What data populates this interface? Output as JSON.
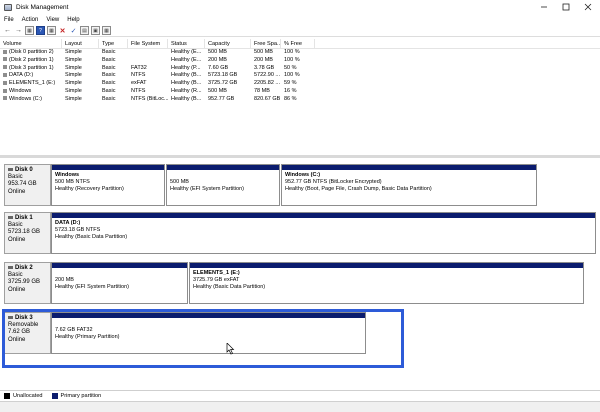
{
  "window": {
    "title": "Disk Management"
  },
  "menu": [
    "File",
    "Action",
    "View",
    "Help"
  ],
  "toolbar": {
    "icons": [
      "back-arrow-icon",
      "forward-arrow-icon",
      "properties-icon",
      "help-icon",
      "refresh-icon",
      "delete-icon",
      "check-icon",
      "properties-sheet-icon",
      "new-volume-icon",
      "layout-icon"
    ]
  },
  "volumes": {
    "headers": [
      "Volume",
      "Layout",
      "Type",
      "File System",
      "Status",
      "Capacity",
      "Free Spa...",
      "% Free"
    ],
    "rows": [
      [
        "(Disk 0 partition 2)",
        "Simple",
        "Basic",
        "",
        "Healthy (E...",
        "500 MB",
        "500 MB",
        "100 %"
      ],
      [
        "(Disk 2 partition 1)",
        "Simple",
        "Basic",
        "",
        "Healthy (E...",
        "200 MB",
        "200 MB",
        "100 %"
      ],
      [
        "(Disk 3 partition 1)",
        "Simple",
        "Basic",
        "FAT32",
        "Healthy (P...",
        "7.60 GB",
        "3.78 GB",
        "50 %"
      ],
      [
        "DATA (D:)",
        "Simple",
        "Basic",
        "NTFS",
        "Healthy (B...",
        "5723.18 GB",
        "5722.90 ...",
        "100 %"
      ],
      [
        "ELEMENTS_1 (E:)",
        "Simple",
        "Basic",
        "exFAT",
        "Healthy (B...",
        "3725.72 GB",
        "2205.82 ...",
        "59 %"
      ],
      [
        "Windows",
        "Simple",
        "Basic",
        "NTFS",
        "Healthy (R...",
        "500 MB",
        "78 MB",
        "16 %"
      ],
      [
        "Windows (C:)",
        "Simple",
        "Basic",
        "NTFS (BitLoc...",
        "Healthy (B...",
        "952.77 GB",
        "820.67 GB",
        "86 %"
      ]
    ]
  },
  "disks": [
    {
      "name": "Disk 0",
      "type": "Basic",
      "size": "953.74 GB",
      "status": "Online",
      "partitions": [
        {
          "name": "Windows",
          "size": "500 MB NTFS",
          "status": "Healthy (Recovery Partition)"
        },
        {
          "name": "",
          "size": "500 MB",
          "status": "Healthy (EFI System Partition)"
        },
        {
          "name": "Windows (C:)",
          "size": "952.77 GB NTFS (BitLocker Encrypted)",
          "status": "Healthy (Boot, Page File, Crash Dump, Basic Data Partition)"
        }
      ]
    },
    {
      "name": "Disk 1",
      "type": "Basic",
      "size": "5723.18 GB",
      "status": "Online",
      "partitions": [
        {
          "name": "DATA (D:)",
          "size": "5723.18 GB NTFS",
          "status": "Healthy (Basic Data Partition)"
        }
      ]
    },
    {
      "name": "Disk 2",
      "type": "Basic",
      "size": "3725.99 GB",
      "status": "Online",
      "partitions": [
        {
          "name": "",
          "size": "200 MB",
          "status": "Healthy (EFI System Partition)"
        },
        {
          "name": "ELEMENTS_1 (E:)",
          "size": "3725.79 GB exFAT",
          "status": "Healthy (Basic Data Partition)"
        }
      ]
    },
    {
      "name": "Disk 3",
      "type": "Removable",
      "size": "7.62 GB",
      "status": "Online",
      "partitions": [
        {
          "name": "",
          "size": "7.62 GB FAT32",
          "status": "Healthy (Primary Partition)"
        }
      ]
    }
  ],
  "legend": [
    {
      "label": "Unallocated",
      "color": "#000000"
    },
    {
      "label": "Primary partition",
      "color": "#0b1c6e"
    }
  ],
  "colors": {
    "partition_bar": "#0b1c6e",
    "selection": "#2d5bd8"
  }
}
